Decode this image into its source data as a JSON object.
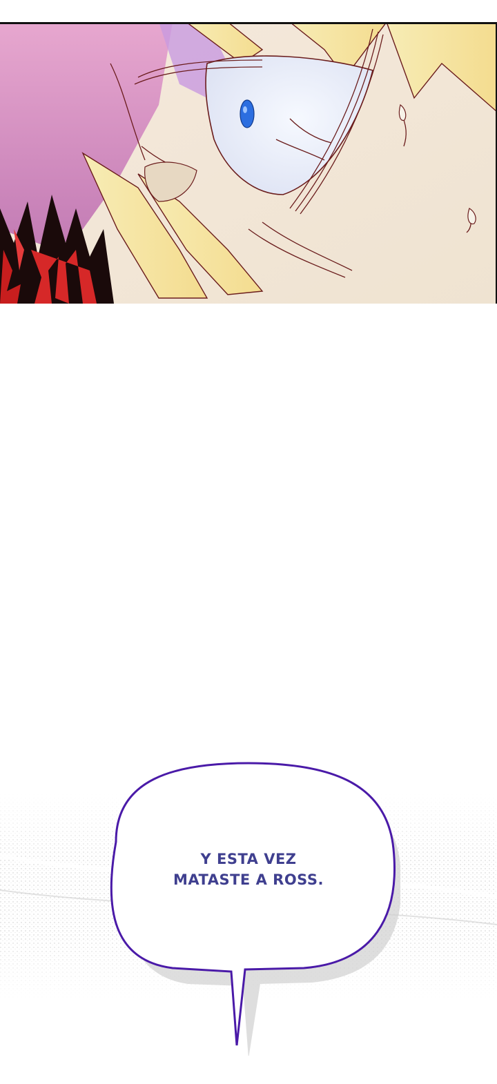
{
  "page": {
    "background": "#ffffff"
  },
  "panel": {
    "description_colors": {
      "hair_blonde": "#f6e6a0",
      "hair_pink": "#d98fc0",
      "skin": "#f3e7d7",
      "eye_white": "#eef3fb",
      "iris_blue": "#2c6ee0",
      "ink": "#6a1c1c",
      "flames_red": "#c81e1e",
      "border": "#111111"
    }
  },
  "speech_bubble": {
    "line1": "Y ESTA VEZ",
    "line2": "MATASTE A ROSS.",
    "outline_color": "#5b2bb8",
    "text_color": "#3f3f8f",
    "fill": "#ffffff"
  }
}
